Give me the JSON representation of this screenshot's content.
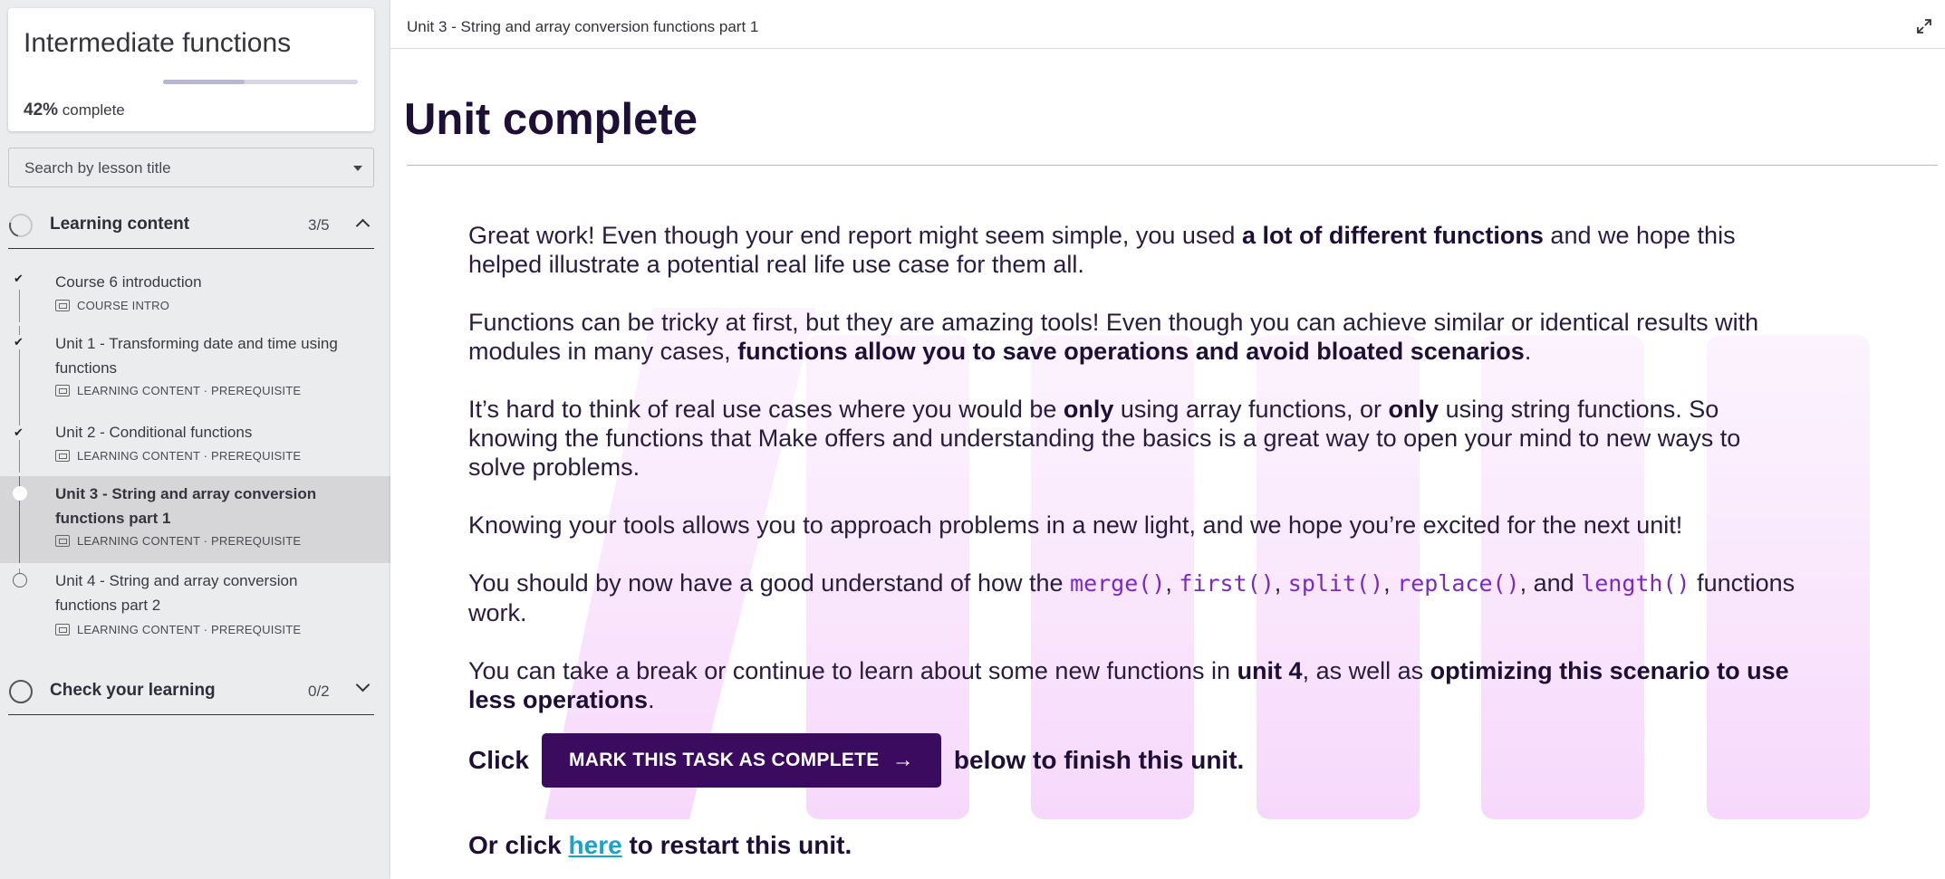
{
  "course": {
    "title": "Intermediate functions",
    "progress_percent": 42,
    "progress_value": "42%",
    "progress_suffix": "complete"
  },
  "search": {
    "placeholder": "Search by lesson title"
  },
  "sections": [
    {
      "label": "Learning content",
      "count": "3/5",
      "expanded": true
    },
    {
      "label": "Check your learning",
      "count": "0/2",
      "expanded": false
    }
  ],
  "lessons": [
    {
      "title": "Course 6 introduction",
      "meta": "COURSE INTRO",
      "status": "done"
    },
    {
      "title": "Unit 1 - Transforming date and time using functions",
      "meta": "LEARNING CONTENT · PREREQUISITE",
      "status": "done"
    },
    {
      "title": "Unit 2 - Conditional functions",
      "meta": "LEARNING CONTENT · PREREQUISITE",
      "status": "done"
    },
    {
      "title": "Unit 3 - String and array conversion functions part 1",
      "meta": "LEARNING CONTENT · PREREQUISITE",
      "status": "current"
    },
    {
      "title": "Unit 4 - String and array conversion functions part 2",
      "meta": "LEARNING CONTENT · PREREQUISITE",
      "status": "todo"
    }
  ],
  "topbar": {
    "breadcrumb": "Unit 3 - String and array conversion functions part 1"
  },
  "content": {
    "heading": "Unit complete",
    "p1": {
      "a": "Great work! Even though your end report might seem simple, you used ",
      "b": "a lot of different functions",
      "c": " and we hope this helped illustrate a potential real life use case for them all."
    },
    "p2": {
      "a": "Functions can be tricky at first, but they are amazing tools! Even though you can achieve similar or identical results with modules in many cases, ",
      "b": "functions allow you to save operations and avoid bloated scenarios",
      "c": "."
    },
    "p3": {
      "a": "It’s hard to think of real use cases where you would be ",
      "b": "only",
      "c": " using array functions, or ",
      "d": "only",
      "e": " using string functions. So knowing the functions that Make offers and understanding the basics is a great way to open your mind to new ways to solve problems."
    },
    "p4": "Knowing your tools allows you to approach problems in a new light, and we hope you’re excited for the next unit!",
    "p5": {
      "a": "You should by now have a good understand of how the ",
      "f1": "merge()",
      "s1": ", ",
      "f2": "first()",
      "s2": ", ",
      "f3": "split()",
      "s3": ", ",
      "f4": "replace()",
      "s4": ", and ",
      "f5": "length()",
      "c": " functions work."
    },
    "p6": {
      "a": "You can take a break or continue to learn about some new functions in ",
      "b": "unit 4",
      "c": ", as well as ",
      "d": "optimizing this scenario to use less operations",
      "e": "."
    },
    "cta": {
      "before": "Click",
      "button": "MARK THIS TASK AS COMPLETE",
      "after": "below to finish this unit."
    },
    "restart": {
      "before": "Or click ",
      "link": "here",
      "after": " to restart this unit."
    }
  },
  "colors": {
    "accent": "#3a0b5e",
    "heading": "#1e0f36",
    "code": "#7a28c9",
    "link": "#1aa3c9",
    "deco": "#e8a8f5"
  }
}
